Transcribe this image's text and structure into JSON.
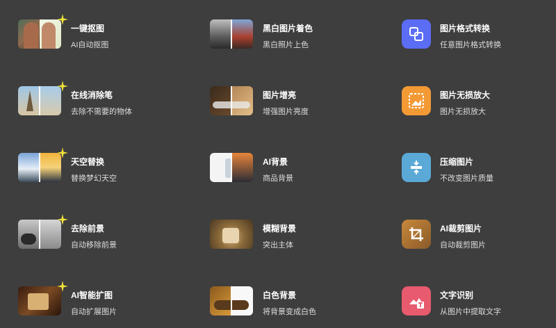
{
  "tools": [
    {
      "id": "cutout",
      "title": "一键抠图",
      "subtitle": "AI自动抠图",
      "ai": true,
      "thumb": "cutout"
    },
    {
      "id": "colorize",
      "title": "黑白图片着色",
      "subtitle": "黑白照片上色",
      "ai": false,
      "thumb": "colorize"
    },
    {
      "id": "format",
      "title": "图片格式转换",
      "subtitle": "任意图片格式转换",
      "ai": false,
      "icon": "convert-icon",
      "icon_color": "#5b6cf5"
    },
    {
      "id": "erase",
      "title": "在线消除笔",
      "subtitle": "去除不需要的物体",
      "ai": true,
      "thumb": "erase"
    },
    {
      "id": "enhance",
      "title": "图片增亮",
      "subtitle": "增强图片亮度",
      "ai": false,
      "thumb": "enhance"
    },
    {
      "id": "upscale",
      "title": "图片无损放大",
      "subtitle": "图片无损放大",
      "ai": false,
      "icon": "upscale-icon",
      "icon_color": "#f39a35"
    },
    {
      "id": "sky",
      "title": "天空替换",
      "subtitle": "替换梦幻天空",
      "ai": true,
      "thumb": "sky"
    },
    {
      "id": "aibg",
      "title": "AI背景",
      "subtitle": "商品背景",
      "ai": false,
      "thumb": "aibg"
    },
    {
      "id": "compress",
      "title": "压缩图片",
      "subtitle": "不改变图片质量",
      "ai": false,
      "icon": "compress-icon",
      "icon_color": "#5aa9d6"
    },
    {
      "id": "foreground",
      "title": "去除前景",
      "subtitle": "自动移除前景",
      "ai": true,
      "thumb": "foreground"
    },
    {
      "id": "blur",
      "title": "模糊背景",
      "subtitle": "突出主体",
      "ai": false,
      "thumb": "blur"
    },
    {
      "id": "crop",
      "title": "AI裁剪图片",
      "subtitle": "自动裁剪图片",
      "ai": false,
      "icon": "crop-icon",
      "icon_color": "#c8893a"
    },
    {
      "id": "expand",
      "title": "AI智能扩图",
      "subtitle": "自动扩展图片",
      "ai": true,
      "thumb": "expand"
    },
    {
      "id": "whitebg",
      "title": "白色背景",
      "subtitle": "将背景变成白色",
      "ai": false,
      "thumb": "whitebg"
    },
    {
      "id": "ocr",
      "title": "文字识别",
      "subtitle": "从图片中提取文字",
      "ai": false,
      "icon": "text-recognition-icon",
      "icon_color": "#e85a6e"
    }
  ]
}
